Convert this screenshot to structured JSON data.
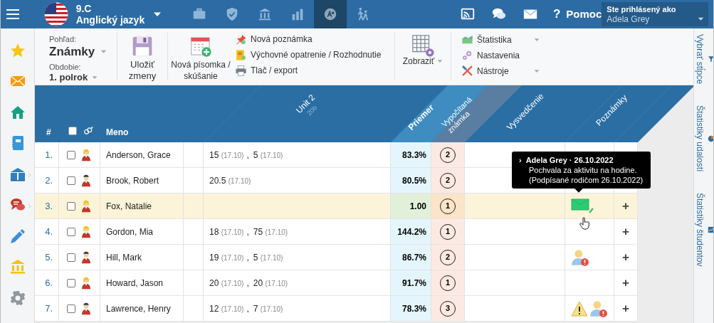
{
  "top_bar": {
    "class_name": "9.C",
    "subject": "Anglický jazyk",
    "nav_icons": [
      {
        "kind": "briefcase",
        "selected": false
      },
      {
        "kind": "shield",
        "selected": false
      },
      {
        "kind": "bank",
        "selected": false
      },
      {
        "kind": "chart",
        "selected": false
      },
      {
        "kind": "grade",
        "selected": true
      },
      {
        "kind": "walk",
        "selected": false
      }
    ],
    "tools": [
      {
        "kind": "cast"
      },
      {
        "kind": "chat"
      },
      {
        "kind": "mail"
      }
    ],
    "help": {
      "glyph": "?",
      "label": "Pomoc"
    },
    "user": {
      "label": "Ste prihlásený ako",
      "name": "Adela Grey"
    }
  },
  "sidebar": {
    "items": [
      {
        "kind": "star",
        "submenu": false
      },
      {
        "kind": "mail",
        "submenu": false
      },
      {
        "kind": "home",
        "submenu": false
      },
      {
        "kind": "notebook",
        "submenu": false
      },
      {
        "kind": "book",
        "submenu": true
      },
      {
        "kind": "chat",
        "submenu": true
      },
      {
        "kind": "pen",
        "submenu": false
      },
      {
        "kind": "bank",
        "submenu": false
      },
      {
        "kind": "gear",
        "submenu": false
      }
    ]
  },
  "toolbar": {
    "view_label": "Pohľad:",
    "view": "Známky",
    "period_label": "Obdobie:",
    "period": "1. polrok",
    "save": "Uložiť zmeny",
    "new_test": "Nová písomka / skúšanie",
    "actions": [
      {
        "kind": "pin",
        "label": "Nová poznámka"
      },
      {
        "kind": "document",
        "label": "Výchovné opatrenie / Rozhodnutie"
      },
      {
        "kind": "print",
        "label": "Tlač / export"
      }
    ],
    "display": "Zobraziť",
    "menus": [
      {
        "kind": "stats",
        "label": "Štatistika",
        "has_menu": true
      },
      {
        "kind": "gears",
        "label": "Nastavenia",
        "has_menu": false
      },
      {
        "kind": "tools",
        "label": "Nástroje",
        "has_menu": true
      }
    ]
  },
  "table": {
    "columns": {
      "number": "#",
      "name": "Meno",
      "unit": "Unit 2",
      "unit_points": "20b",
      "average": "Priemer",
      "computed": "Vypočítaná známka",
      "report": "Vysvedčenie",
      "notes": "Poznámky"
    },
    "select_all": {
      "checked": false
    },
    "separator": ",",
    "rows": [
      {
        "number": "1.",
        "name": "Anderson, Grace",
        "kind": "blond",
        "checked": false,
        "highlighted": false,
        "grades": [
          {
            "value": "15",
            "date": "(17.10)"
          },
          {
            "value": "5",
            "date": "(17.10)"
          }
        ],
        "average": "83.3%",
        "computed": "2",
        "notes": [],
        "add": null
      },
      {
        "number": "2.",
        "name": "Brook, Robert",
        "kind": "dark",
        "checked": false,
        "highlighted": false,
        "grades": [
          {
            "value": "20.5",
            "date": "(17.10)"
          }
        ],
        "average": "80.5%",
        "computed": "2",
        "notes": [],
        "add": null
      },
      {
        "number": "3.",
        "name": "Fox, Natalie",
        "kind": "blond",
        "checked": false,
        "highlighted": true,
        "grades": [],
        "average": "1.00",
        "computed": "1",
        "notes": [
          {
            "kind": "message"
          }
        ],
        "add": "+"
      },
      {
        "number": "4.",
        "name": "Gordon, Mia",
        "kind": "blond",
        "checked": false,
        "highlighted": false,
        "grades": [
          {
            "value": "18",
            "date": "(17.10)"
          },
          {
            "value": "75",
            "date": "(17.10)"
          }
        ],
        "average": "144.2%",
        "computed": "1",
        "notes": [],
        "add": "+"
      },
      {
        "number": "5.",
        "name": "Hill, Mark",
        "kind": "dark",
        "checked": false,
        "highlighted": false,
        "grades": [
          {
            "value": "19",
            "date": "(17.10)"
          },
          {
            "value": "5",
            "date": "(17.10)"
          }
        ],
        "average": "86.7%",
        "computed": "2",
        "notes": [
          {
            "kind": "parent-alert"
          }
        ],
        "add": "+"
      },
      {
        "number": "6.",
        "name": "Howard, Jason",
        "kind": "blond",
        "checked": false,
        "highlighted": false,
        "grades": [
          {
            "value": "20",
            "date": "(17.10)"
          },
          {
            "value": "20",
            "date": "(17.10)"
          }
        ],
        "average": "91.7%",
        "computed": "1",
        "notes": [],
        "add": "+"
      },
      {
        "number": "7.",
        "name": "Lawrence, Henry",
        "kind": "dark",
        "checked": false,
        "highlighted": false,
        "grades": [
          {
            "value": "12",
            "date": "(17.10)"
          },
          {
            "value": "7",
            "date": "(17.10)"
          }
        ],
        "average": "78.3%",
        "computed": "3",
        "notes": [
          {
            "kind": "warning"
          },
          {
            "kind": "parent-alert"
          }
        ],
        "add": "+"
      }
    ]
  },
  "tooltip": {
    "marker": "›",
    "title": "Adela Grey · 26.10.2022",
    "lines": [
      "Pochvala za aktivitu na hodine.",
      "(Podpísané rodičom 26.10.2022)"
    ]
  },
  "right_sidebar": {
    "items": [
      {
        "kind": "filter",
        "label": "Vybrať stĺpce"
      },
      {
        "kind": "pie",
        "label": "Štatistiky udalostí"
      },
      {
        "kind": "chart",
        "label": "Štatistiky študentov"
      }
    ]
  }
}
